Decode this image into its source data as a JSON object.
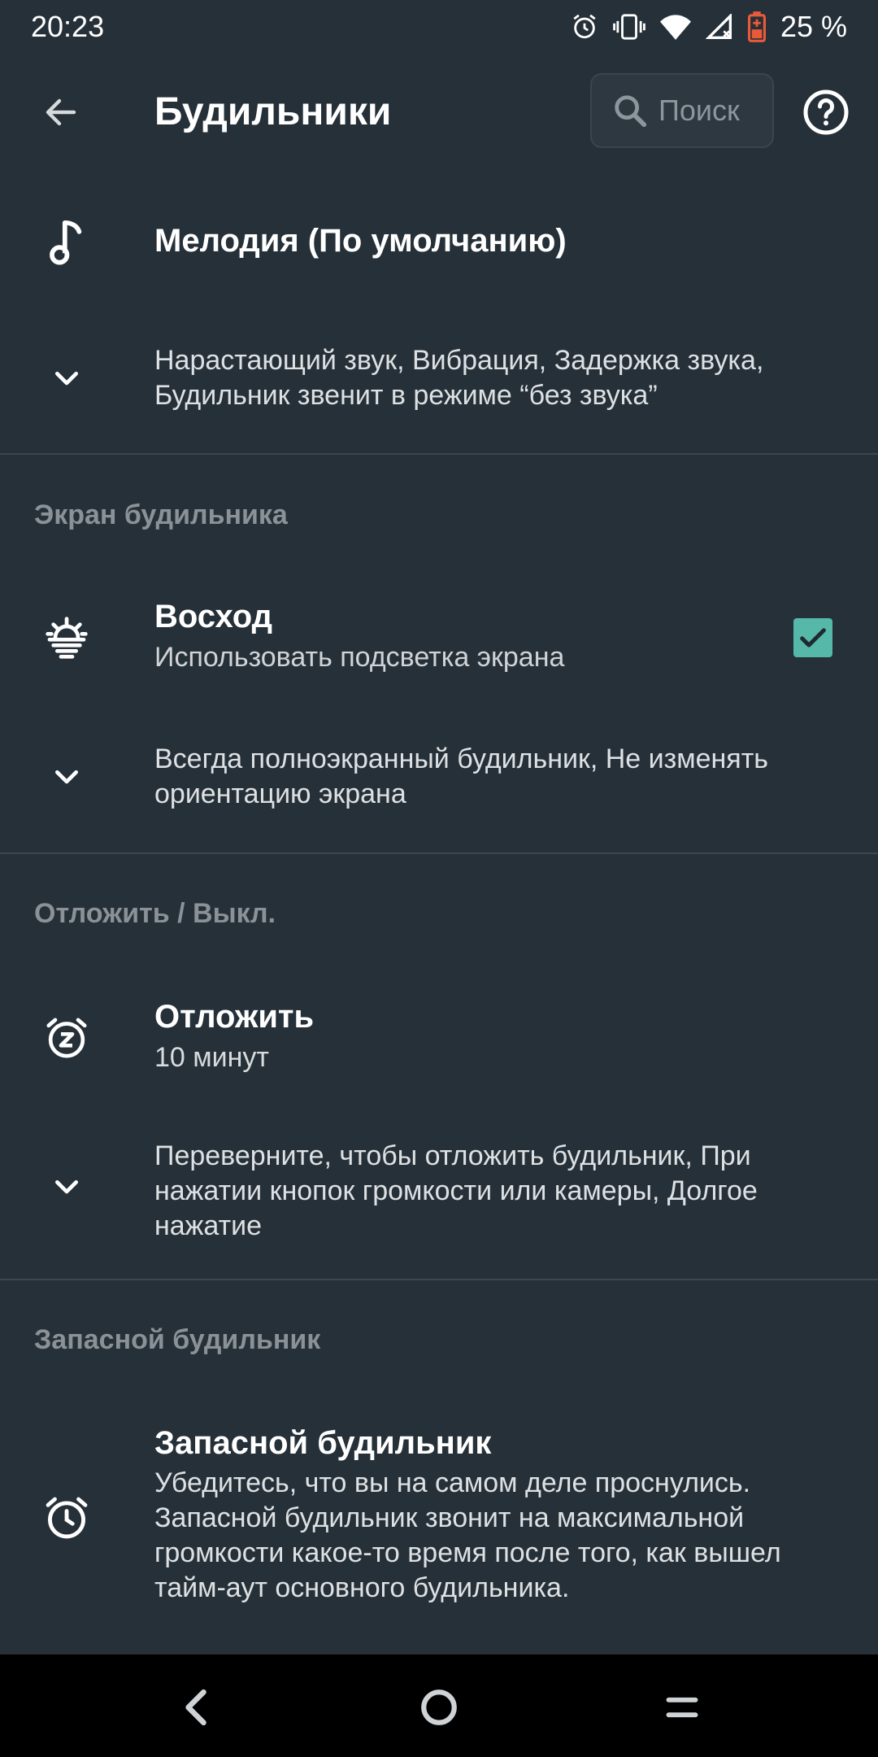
{
  "status": {
    "time": "20:23",
    "battery": "25 %"
  },
  "header": {
    "title": "Будильники",
    "search_placeholder": "Поиск"
  },
  "sound": {
    "title": "Мелодия (По умолчанию)",
    "expand_summary": "Нарастающий звук, Вибрация, Задержка звука, Будильник звенит в режиме “без звука”"
  },
  "alarm_screen": {
    "section": "Экран будильника",
    "title": "Восход",
    "subtitle": "Использовать подсветка экрана",
    "checked": true,
    "expand_summary": "Всегда полноэкранный будильник, Не изменять ориентацию экрана"
  },
  "snooze": {
    "section": "Отложить / Выкл.",
    "title": "Отложить",
    "subtitle": "10 минут",
    "expand_summary": "Переверните, чтобы отложить будильник, При нажатии кнопок громкости или камеры, Долгое нажатие"
  },
  "backup": {
    "section": "Запасной будильник",
    "title": "Запасной будильник",
    "description": "Убедитесь, что вы на самом деле проснулись. Запасной будильник звонит на максимальной громкости какое-то время после того, как вышел тайм-аут основного будильника."
  },
  "colors": {
    "background": "#263038",
    "accent": "#55b8a8",
    "nav": "#000000"
  },
  "icons": {
    "back": "arrow-left-icon",
    "search": "search-icon",
    "help": "help-icon",
    "music": "music-note-icon",
    "expand": "chevron-down-icon",
    "sunrise": "sunrise-icon",
    "snooze": "snooze-icon",
    "backup": "alarm-clock-icon"
  }
}
